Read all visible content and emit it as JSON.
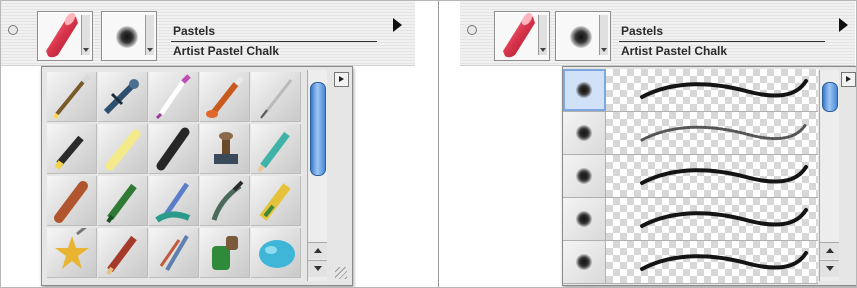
{
  "left_panel": {
    "category": "Pastels",
    "variant": "Artist Pastel Chalk",
    "popup_view": "grid",
    "brush_grid_icons": [
      [
        "fine-brush-icon",
        "airbrush-icon",
        "watercolor-brush-icon",
        "oil-paint-brush-icon",
        "calligraphy-pen-icon"
      ],
      [
        "marker-icon",
        "yellow-chalk-icon",
        "charcoal-stick-icon",
        "image-stamp-icon",
        "colored-pencil-icon"
      ],
      [
        "oil-pastel-icon",
        "felt-pen-icon",
        "blender-icon",
        "palette-knife-icon",
        "crayon-icon"
      ],
      [
        "f-x-star-icon",
        "red-pencil-icon",
        "liquid-ink-icon",
        "pattern-pen-icon",
        "cloner-sponge-icon"
      ]
    ]
  },
  "right_panel": {
    "category": "Pastels",
    "variant": "Artist Pastel Chalk",
    "popup_view": "stroke-list",
    "stroke_rows": [
      {
        "dab": "round-soft-dab-icon",
        "stroke": "smooth-stroke",
        "selected": true
      },
      {
        "dab": "round-soft-dab-icon",
        "stroke": "grainy-stroke",
        "selected": false
      },
      {
        "dab": "round-soft-dab-icon",
        "stroke": "smooth-stroke",
        "selected": false
      },
      {
        "dab": "round-soft-dab-icon",
        "stroke": "smooth-stroke",
        "selected": false
      },
      {
        "dab": "round-soft-dab-icon",
        "stroke": "smooth-stroke",
        "selected": false
      }
    ]
  },
  "colors": {
    "scroll_thumb": "#6fa3e6",
    "pastel_red": "#d8334a",
    "selection": "#7ea6df"
  }
}
